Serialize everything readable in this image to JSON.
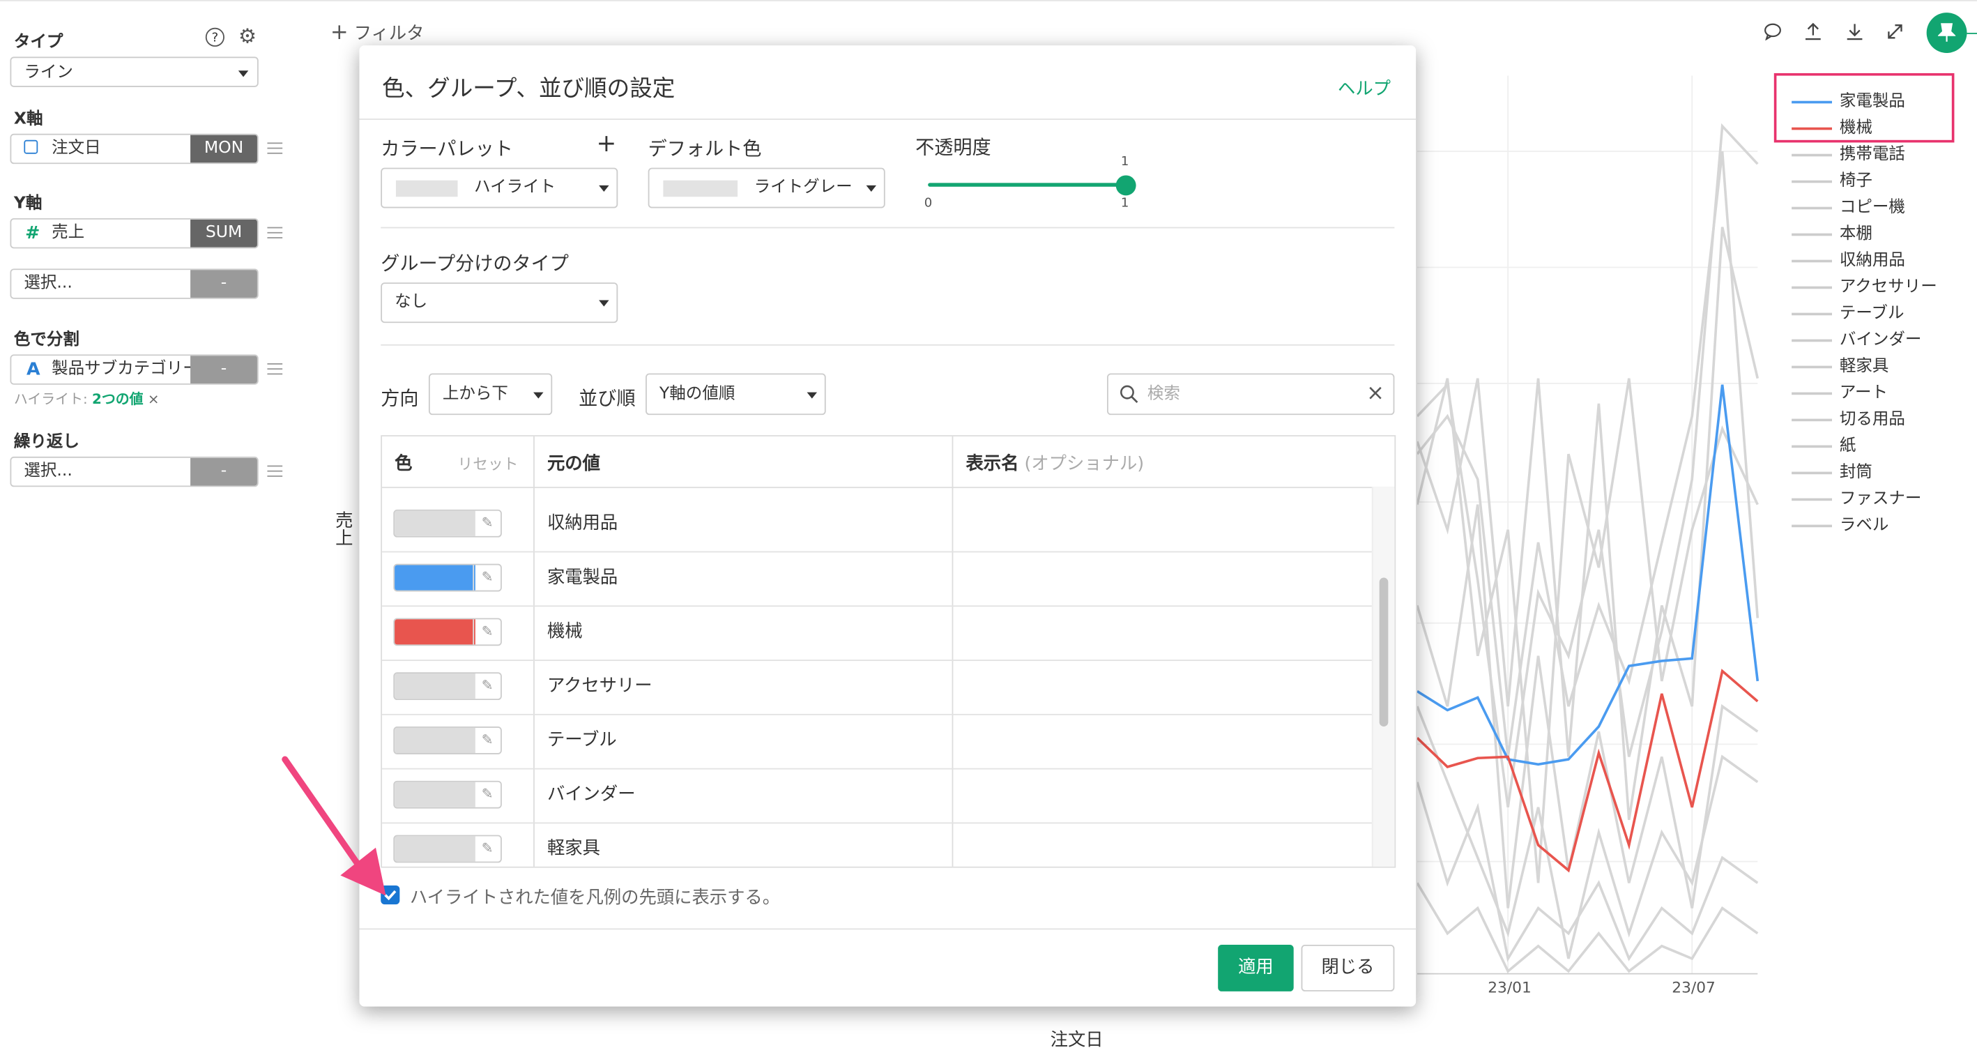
{
  "sidebar": {
    "type_label": "タイプ",
    "type_value": "ライン",
    "xaxis_label": "X軸",
    "xaxis_field": "注文日",
    "xaxis_agg": "MON",
    "yaxis_label": "Y軸",
    "yaxis_field": "売上",
    "yaxis_agg": "SUM",
    "yaxis2_placeholder": "選択...",
    "yaxis2_tag": "-",
    "color_label": "色で分割",
    "color_field": "製品サブカテゴリー",
    "color_tag": "-",
    "highlight_prefix": "ハイライト: ",
    "highlight_value": "2つの値",
    "highlight_close": "×",
    "repeat_label": "繰り返し",
    "repeat_placeholder": "選択...",
    "repeat_tag": "-"
  },
  "toolbar": {
    "filter_plus": "+",
    "filter_label": "フィルタ"
  },
  "modal": {
    "title": "色、グループ、並び順の設定",
    "help": "ヘルプ",
    "palette_label": "カラーパレット",
    "palette_plus": "+",
    "palette_value": "ハイライト",
    "default_color_label": "デフォルト色",
    "default_color_value": "ライトグレー",
    "opacity_label": "不透明度",
    "opacity_value": 1,
    "opacity_min": "0",
    "opacity_max": "1",
    "opacity_current": "1",
    "group_type_label": "グループ分けのタイプ",
    "group_type_value": "なし",
    "direction_label": "方向",
    "direction_value": "上から下",
    "sort_label": "並び順",
    "sort_value": "Y軸の値順",
    "search_placeholder": "検索",
    "search_clear": "×",
    "table": {
      "col_color": "色",
      "col_reset": "リセット",
      "col_original": "元の値",
      "col_display": "表示名",
      "col_display_optional": "(オプショナル)",
      "rows": [
        {
          "value": "収納用品",
          "color": "#dddddd"
        },
        {
          "value": "家電製品",
          "color": "#4a9bf0"
        },
        {
          "value": "機械",
          "color": "#e8554e"
        },
        {
          "value": "アクセサリー",
          "color": "#dddddd"
        },
        {
          "value": "テーブル",
          "color": "#dddddd"
        },
        {
          "value": "バインダー",
          "color": "#dddddd"
        },
        {
          "value": "軽家具",
          "color": "#dddddd"
        }
      ]
    },
    "checkbox_label": "ハイライトされた値を凡例の先頭に表示する。",
    "apply": "適用",
    "close": "閉じる"
  },
  "chart": {
    "ylabel": "売上",
    "xlabel": "注文日",
    "xticks": [
      "23/01",
      "23/07"
    ]
  },
  "legend": [
    {
      "name": "家電製品",
      "color": "#4a9bf0"
    },
    {
      "name": "機械",
      "color": "#e8554e"
    },
    {
      "name": "携帯電話",
      "color": "#cccccc"
    },
    {
      "name": "椅子",
      "color": "#cccccc"
    },
    {
      "name": "コピー機",
      "color": "#cccccc"
    },
    {
      "name": "本棚",
      "color": "#cccccc"
    },
    {
      "name": "収納用品",
      "color": "#cccccc"
    },
    {
      "name": "アクセサリー",
      "color": "#cccccc"
    },
    {
      "name": "テーブル",
      "color": "#cccccc"
    },
    {
      "name": "バインダー",
      "color": "#cccccc"
    },
    {
      "name": "軽家具",
      "color": "#cccccc"
    },
    {
      "name": "アート",
      "color": "#cccccc"
    },
    {
      "name": "切る用品",
      "color": "#cccccc"
    },
    {
      "name": "紙",
      "color": "#cccccc"
    },
    {
      "name": "封筒",
      "color": "#cccccc"
    },
    {
      "name": "ファスナー",
      "color": "#cccccc"
    },
    {
      "name": "ラベル",
      "color": "#cccccc"
    }
  ],
  "colors": {
    "accent": "#12a571",
    "highlight_box": "#e8336d",
    "arrow": "#f0457f"
  }
}
